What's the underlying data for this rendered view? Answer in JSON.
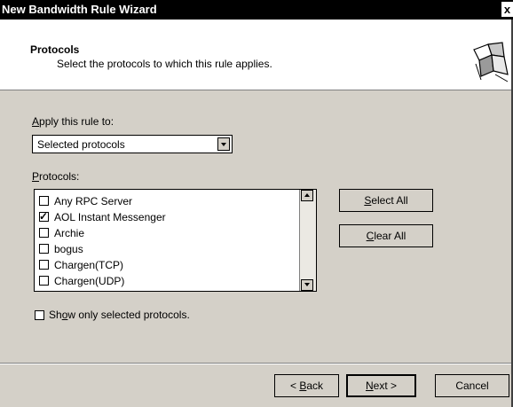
{
  "window": {
    "title": "New Bandwidth Rule Wizard",
    "close_glyph": "x"
  },
  "header": {
    "title": "Protocols",
    "subtitle": "Select the protocols to which this rule applies.",
    "icon": "wizard-puzzle-icon"
  },
  "apply": {
    "label_mnemonic": "A",
    "label_rest": "pply this rule to:",
    "selected": "Selected protocols"
  },
  "protocols": {
    "label_mnemonic": "P",
    "label_rest": "rotocols:",
    "items": [
      {
        "label": "Any RPC Server",
        "checked": false
      },
      {
        "label": "AOL Instant Messenger",
        "checked": true
      },
      {
        "label": "Archie",
        "checked": false
      },
      {
        "label": "bogus",
        "checked": false
      },
      {
        "label": "Chargen(TCP)",
        "checked": false
      },
      {
        "label": "Chargen(UDP)",
        "checked": false
      }
    ]
  },
  "buttons": {
    "select_all_mnemonic": "S",
    "select_all_rest": "elect All",
    "clear_all_mnemonic": "C",
    "clear_all_rest": "lear All"
  },
  "show_only": {
    "pre": "Sh",
    "mnemonic": "o",
    "post": "w only selected protocols.",
    "checked": false
  },
  "footer": {
    "back_pre": "< ",
    "back_mnemonic": "B",
    "back_post": "ack",
    "next_mnemonic": "N",
    "next_post": "ext >",
    "cancel": "Cancel"
  }
}
